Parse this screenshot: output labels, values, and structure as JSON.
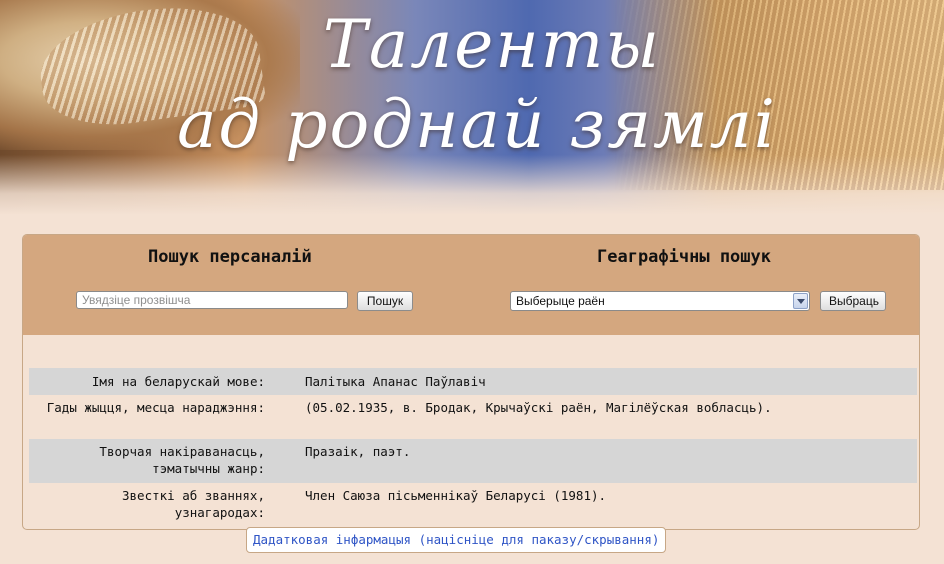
{
  "banner": {
    "title_line1": "Таленты",
    "title_line2": "ад роднай зямлі"
  },
  "search": {
    "persons_title": "Пошук персаналій",
    "geo_title": "Геаграфічны пошук",
    "name_placeholder": "Увядзіце прозвішча",
    "name_value": "",
    "search_button": "Пошук",
    "district_select_value": "Выберыце раён",
    "choose_button": "Выбраць"
  },
  "person": {
    "rows": [
      {
        "label": "Імя на беларускай мове:",
        "value": "Палітыка Апанас Паўлавіч"
      },
      {
        "label": "Гады жыцця, месца нараджэння:",
        "value": "(05.02.1935, в. Бродак, Крычаўскі раён, Магілёўская вобласць)."
      },
      {
        "label": "Творчая накіраванасць, тэматычны жанр:",
        "value": "Празаік, паэт."
      },
      {
        "label": "Звесткі аб званнях, узнагародах:",
        "value": "Член Саюза пісьменнікаў Беларусі (1981)."
      }
    ]
  },
  "more_link": "Дадатковая інфармацыя (націсніце для паказу/скрывання)",
  "colors": {
    "page_bg": "#f4e2d4",
    "panel_head": "#d4a77f",
    "row_shade": "#d6d6d6",
    "link": "#2f55c6"
  }
}
